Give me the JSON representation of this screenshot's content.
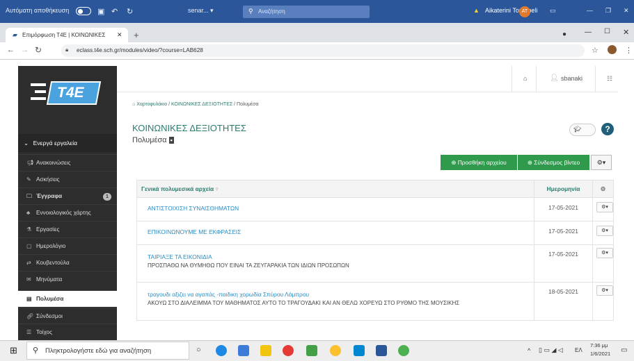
{
  "officebar": {
    "autosave": "Αυτόματη αποθήκευση",
    "filename": "senar... ▾",
    "search": "Αναζήτηση",
    "user": "Aikaterini Toumpeli",
    "initials": "AT"
  },
  "browser": {
    "tab_title": "Επιμόρφωση T4E | ΚΟΙΝΩΝΙΚΕΣ",
    "url": "eclass.t4e.sch.gr/modules/video/?course=LAB628"
  },
  "logo": "T4E",
  "header": {
    "username": "sbanaki"
  },
  "sidebar": {
    "section": "Ενεργά εργαλεία",
    "items": [
      {
        "label": "Ανακοινώσεις",
        "icon": "megaphone-icon"
      },
      {
        "label": "Ασκήσεις",
        "icon": "pencil-icon"
      },
      {
        "label": "Έγγραφα",
        "icon": "folder-icon",
        "badge": "1"
      },
      {
        "label": "Εννοιολογικός χάρτης",
        "icon": "sitemap-icon"
      },
      {
        "label": "Εργασίες",
        "icon": "flask-icon"
      },
      {
        "label": "Ημερολόγιο",
        "icon": "calendar-icon"
      },
      {
        "label": "Κουβεντούλα",
        "icon": "exchange-icon"
      },
      {
        "label": "Μηνύματα",
        "icon": "envelope-icon"
      },
      {
        "label": "Πολυμέσα",
        "icon": "film-icon"
      },
      {
        "label": "Σύνδεσμοι",
        "icon": "link-icon"
      },
      {
        "label": "Τοίχος",
        "icon": "list-icon"
      }
    ]
  },
  "breadcrumb": {
    "home": "Χαρτοφυλάκιο",
    "course": "ΚΟΙΝΩΝΙΚΕΣ ΔΕΞΙΟΤΗΤΕΣ",
    "current": "Πολυμέσα"
  },
  "course_title": "ΚΟΙΝΩΝΙΚΕΣ ΔΕΞΙΟΤΗΤΕΣ",
  "page_subtitle": "Πολυμέσα",
  "buttons": {
    "add_file": "Προσθήκη αρχείου",
    "add_link": "Σύνδεσμος βίντεο"
  },
  "table": {
    "header_title": "Γενικά πολυμεσικά αρχεία",
    "header_date": "Ημερομηνία",
    "rows": [
      {
        "title": "ΑΝΤΙΣΤΟΙΧΙΣΗ ΣΥΝΑΙΣΘΗΜΑΤΩΝ",
        "desc": "",
        "date": "17-05-2021"
      },
      {
        "title": "ΕΠΙΚΟΙΝΩΝΟΥΜΕ ΜΕ ΕΚΦΡΑΣΕΙΣ",
        "desc": "",
        "date": "17-05-2021"
      },
      {
        "title": "ΤΑΙΡΙΑΞΕ ΤΑ ΕΙΚΟΝΙΔΙΑ",
        "desc": "ΠΡΟΣΠΑΘΩ ΝΑ ΘΥΜΗΘΩ ΠΟΥ ΕΙΝΑΙ ΤΑ ΖΕΥΓΑΡΑΚΙΑ ΤΩΝ ΙΔΙΩΝ ΠΡΟΣΩΠΩΝ",
        "date": "17-05-2021"
      },
      {
        "title": "τραγουδι αξιζει να αγαπάς -παιδικη χορωδία Σπύρου Λάμπρου",
        "desc": "ΑΚΟΥΩ ΣΤΟ ΔΙΑΛΕΙΜΜΑ ΤΟΥ ΜΑΘΗΜΑΤΟΣ ΑΥΤΟ ΤΟ ΤΡΑΓΟΥΔΑΚΙ ΚΑΙ ΑΝ ΘΕΛΩ ΧΟΡΕΥΩ ΣΤΟ ΡΥΘΜΟ ΤΗΣ ΜΟΥΣΙΚΗΣ",
        "date": "18-05-2021"
      }
    ]
  },
  "taskbar": {
    "search": "Πληκτρολογήστε εδώ για αναζήτηση",
    "lang": "ΕΛ",
    "time": "7:36 μμ",
    "date": "1/6/2021"
  },
  "colors": {
    "accent": "#2a7c6d",
    "green": "#2f9a4c",
    "office": "#2b579a"
  }
}
